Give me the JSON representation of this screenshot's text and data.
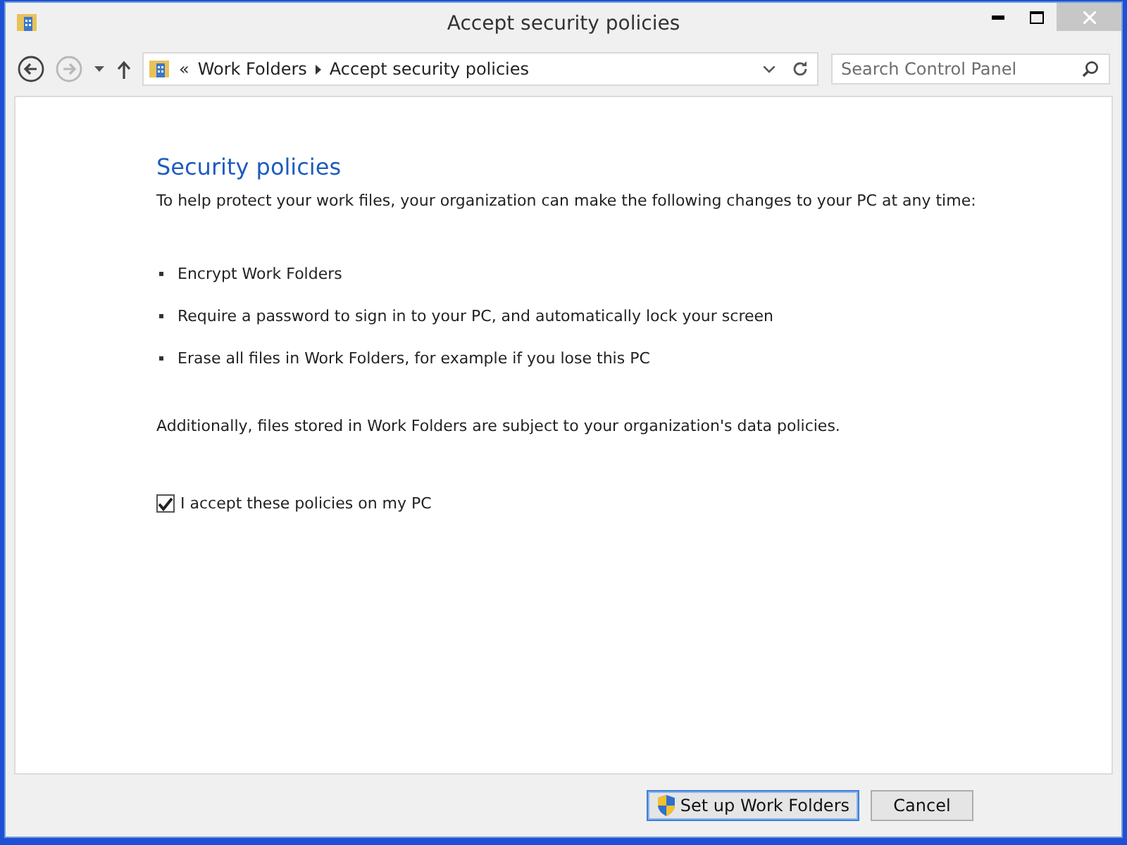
{
  "window": {
    "title": "Accept security policies"
  },
  "nav_buttons": [
    {
      "kind": "back",
      "disabled": false
    },
    {
      "kind": "forward",
      "disabled": true
    }
  ],
  "address_bar": {
    "overflow": "«",
    "crumbs": [
      "Work Folders",
      "Accept security policies"
    ]
  },
  "search": {
    "placeholder": "Search Control Panel"
  },
  "heading": "Security policies",
  "intro": "To help protect your work files, your organization can make the following changes to your PC at any time:",
  "policies": [
    "Encrypt Work Folders",
    "Require a password to sign in to your PC, and automatically lock your screen",
    "Erase all files in Work Folders, for example if you lose this PC"
  ],
  "note": "Additionally, files stored in Work Folders are subject to your organization's data policies.",
  "accept": {
    "label": "I accept these policies on my PC",
    "checked": true
  },
  "buttons": [
    {
      "kind": "admin",
      "label": "Set up Work Folders",
      "focused": true
    },
    {
      "kind": "plain",
      "label": "Cancel",
      "focused": false
    }
  ]
}
